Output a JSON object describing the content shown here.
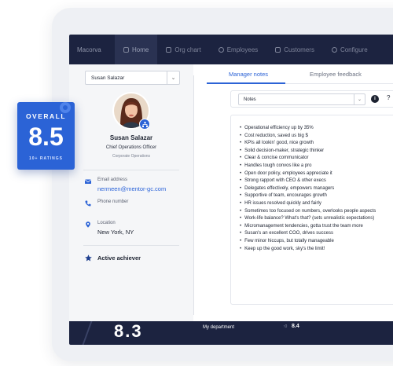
{
  "nav": {
    "brand": "Macorva",
    "items": [
      {
        "label": "Home",
        "active": true
      },
      {
        "label": "Org chart",
        "active": false
      },
      {
        "label": "Employees",
        "active": false
      },
      {
        "label": "Customers",
        "active": false
      },
      {
        "label": "Configure",
        "active": false
      }
    ]
  },
  "profile": {
    "selected_person": "Susan Salazar",
    "name": "Susan Salazar",
    "title": "Chief Operations Officer",
    "org": "Corporate Operations",
    "email_label": "Email address",
    "email": "nermeen@mentor-gc.com",
    "phone_label": "Phone number",
    "location_label": "Location",
    "location": "New York, NY",
    "achievement": "Active achiever"
  },
  "tabs": {
    "manager_notes": "Manager notes",
    "employee_feedback": "Employee feedback"
  },
  "notes": {
    "select_value": "Notes",
    "info_glyph": "i",
    "cut_char": "?",
    "items": [
      "Operational efficiency up by 35%",
      "Cost reduction, saved us big $",
      "KPIs all lookin' good, nice growth",
      "Solid decision-maker, strategic thinker",
      "Clear & concise communicator",
      "Handles tough convos like a pro",
      "Open door policy, employees appreciate it",
      "Strong rapport with CEO & other execs",
      "Delegates effectively, empowers managers",
      "Supportive of team, encourages growth",
      "HR issues resolved quickly and fairly",
      "Sometimes too focused on numbers, overlooks people aspects",
      "Work-life balance? What's that? (sets unrealistic expectations)",
      "Micromanagement tendencies, gotta trust the team more",
      "Susan's an excellent COO, drives success",
      "Few minor hiccups, but totally manageable",
      "Keep up the good work, sky's the limit!"
    ]
  },
  "bottom": {
    "big_number": "8.3",
    "label": "My department",
    "small_prefix": "↑0",
    "small_number": "8.4"
  },
  "badge": {
    "overall": "OVERALL",
    "score": "8.5",
    "ratings": "10+ RATINGS"
  },
  "colors": {
    "accent": "#2c63d6",
    "nav_bg": "#1c2340",
    "panel_bg": "#f5f6f8"
  }
}
